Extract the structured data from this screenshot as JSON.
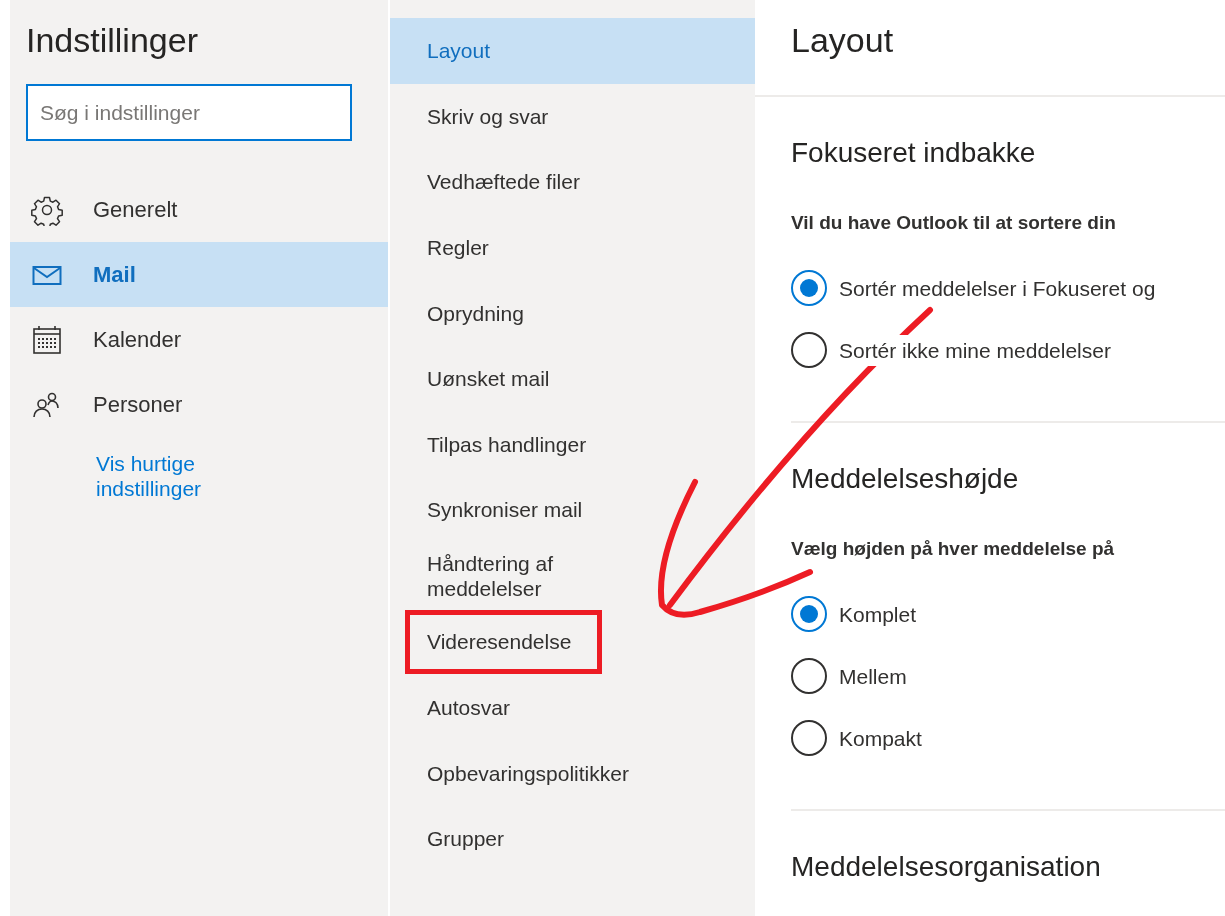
{
  "settings_panel": {
    "title": "Indstillinger",
    "search": {
      "placeholder": "Søg i indstillinger"
    },
    "items": [
      {
        "label": "Generelt",
        "selected": false
      },
      {
        "label": "Mail",
        "selected": true
      },
      {
        "label": "Kalender",
        "selected": false
      },
      {
        "label": "Personer",
        "selected": false
      }
    ],
    "link": "Vis hurtige indstillinger"
  },
  "subsections": [
    {
      "label": "Layout",
      "selected": true,
      "highlighted": false
    },
    {
      "label": "Skriv og svar",
      "selected": false,
      "highlighted": false
    },
    {
      "label": "Vedhæftede filer",
      "selected": false,
      "highlighted": false
    },
    {
      "label": "Regler",
      "selected": false,
      "highlighted": false
    },
    {
      "label": "Oprydning",
      "selected": false,
      "highlighted": false
    },
    {
      "label": "Uønsket mail",
      "selected": false,
      "highlighted": false
    },
    {
      "label": "Tilpas handlinger",
      "selected": false,
      "highlighted": false
    },
    {
      "label": "Synkroniser mail",
      "selected": false,
      "highlighted": false
    },
    {
      "label": "Håndtering af meddelelser",
      "selected": false,
      "highlighted": false
    },
    {
      "label": "Videresendelse",
      "selected": false,
      "highlighted": true
    },
    {
      "label": "Autosvar",
      "selected": false,
      "highlighted": false
    },
    {
      "label": "Opbevaringspolitikker",
      "selected": false,
      "highlighted": false
    },
    {
      "label": "Grupper",
      "selected": false,
      "highlighted": false
    }
  ],
  "content": {
    "title": "Layout",
    "sections": [
      {
        "heading": "Fokuseret indbakke",
        "question": "Vil du have Outlook til at sortere din",
        "options": [
          {
            "label": "Sortér meddelelser i Fokuseret og",
            "selected": true
          },
          {
            "label": "Sortér ikke mine meddelelser",
            "selected": false
          }
        ]
      },
      {
        "heading": "Meddelelseshøjde",
        "question": "Vælg højden på hver meddelelse på",
        "options": [
          {
            "label": "Komplet",
            "selected": true
          },
          {
            "label": "Mellem",
            "selected": false
          },
          {
            "label": "Kompakt",
            "selected": false
          }
        ]
      },
      {
        "heading": "Meddelelsesorganisation"
      }
    ]
  },
  "annotation": {
    "arrow": true
  }
}
